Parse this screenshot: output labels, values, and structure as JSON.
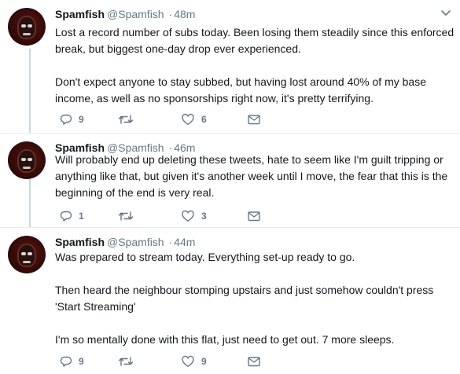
{
  "tweets": [
    {
      "name": "Spamfish",
      "handle": "@Spamfish",
      "separator": "·",
      "time": "48m",
      "paragraphs": [
        "Lost a record number of subs today. Been losing them steadily since this enforced break, but biggest one-day drop ever experienced.",
        "Don't expect anyone to stay subbed, but having lost around 40% of my base income, as well as no sponsorships right now, it's pretty terrifying."
      ],
      "reply_count": "9",
      "retweet_count": "",
      "like_count": "6"
    },
    {
      "name": "Spamfish",
      "handle": "@Spamfish",
      "separator": "·",
      "time": "46m",
      "paragraphs": [
        "Will probably end up deleting these tweets, hate to seem like I'm guilt tripping or anything like that, but given it's another week until I move, the fear that this is the beginning of the end is very real."
      ],
      "reply_count": "1",
      "retweet_count": "",
      "like_count": "3"
    },
    {
      "name": "Spamfish",
      "handle": "@Spamfish",
      "separator": "·",
      "time": "44m",
      "paragraphs": [
        "Was prepared to stream today. Everything set-up ready to go.",
        "Then heard the neighbour stomping upstairs and just somehow couldn't press 'Start Streaming'",
        "I'm so mentally done with this flat,  just need to get out. 7 more sleeps."
      ],
      "reply_count": "9",
      "retweet_count": "",
      "like_count": "9"
    }
  ],
  "colors": {
    "text": "#14171a",
    "secondary": "#657786",
    "thread_line": "#ccd6dd",
    "divider": "#e6ecf0"
  },
  "icons": [
    "caret-down-icon",
    "reply-icon",
    "retweet-icon",
    "like-icon",
    "direct-message-icon"
  ]
}
